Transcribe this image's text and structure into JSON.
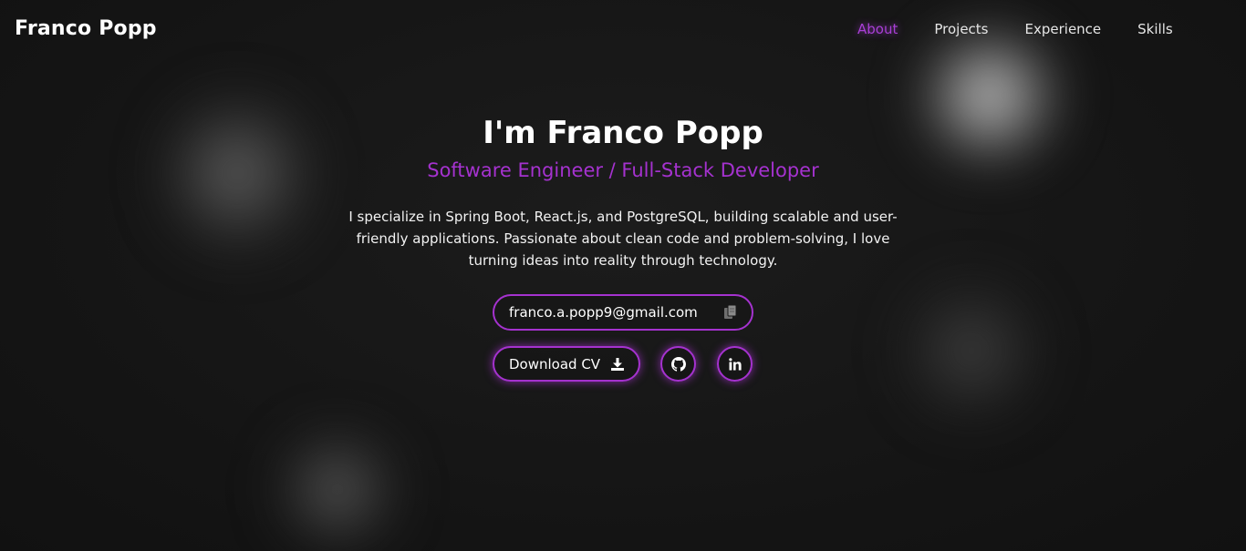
{
  "brand": "Franco Popp",
  "nav": {
    "items": [
      {
        "label": "About",
        "active": true
      },
      {
        "label": "Projects",
        "active": false
      },
      {
        "label": "Experience",
        "active": false
      },
      {
        "label": "Skills",
        "active": false
      }
    ]
  },
  "hero": {
    "title": "I'm Franco Popp",
    "subtitle": "Software Engineer / Full-Stack Developer",
    "description": "I specialize in Spring Boot, React.js, and PostgreSQL, building scalable and user-friendly applications. Passionate about clean code and problem-solving, I love turning ideas into reality through technology."
  },
  "contact": {
    "email": "franco.a.popp9@gmail.com",
    "copy_icon": "copy-icon"
  },
  "actions": {
    "download_cv_label": "Download CV",
    "download_icon": "download-icon",
    "github_icon": "github-icon",
    "linkedin_icon": "linkedin-icon"
  },
  "colors": {
    "accent": "#a532cf",
    "background": "#131313",
    "text": "#ffffff"
  }
}
